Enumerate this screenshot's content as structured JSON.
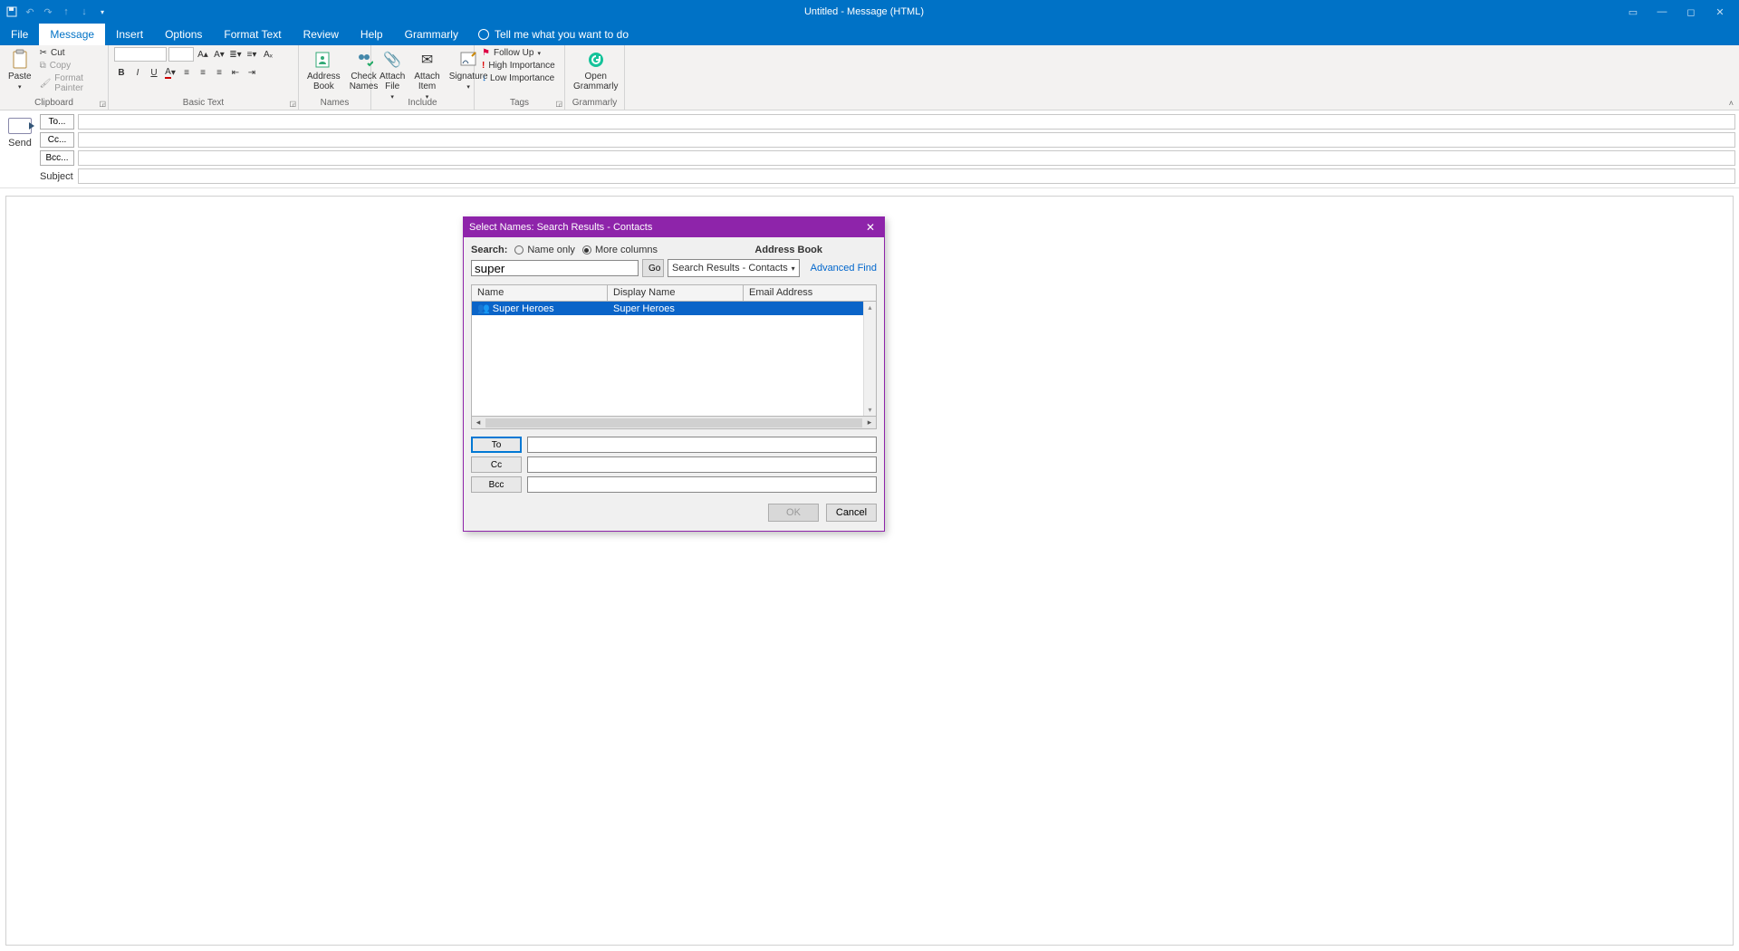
{
  "window": {
    "title": "Untitled  -  Message (HTML)"
  },
  "qat": {
    "save": "💾"
  },
  "tabs": {
    "file": "File",
    "message": "Message",
    "insert": "Insert",
    "options": "Options",
    "format_text": "Format Text",
    "review": "Review",
    "help": "Help",
    "grammarly": "Grammarly",
    "tell_me": "Tell me what you want to do"
  },
  "ribbon": {
    "clipboard": {
      "paste": "Paste",
      "cut": "Cut",
      "copy": "Copy",
      "format_painter": "Format Painter",
      "label": "Clipboard"
    },
    "basic_text": {
      "label": "Basic Text"
    },
    "names": {
      "address_book": "Address\nBook",
      "check_names": "Check\nNames",
      "label": "Names"
    },
    "include": {
      "attach_file": "Attach\nFile",
      "attach_item": "Attach\nItem",
      "signature": "Signature",
      "label": "Include"
    },
    "tags": {
      "follow_up": "Follow Up",
      "high": "High Importance",
      "low": "Low Importance",
      "label": "Tags"
    },
    "grammarly_group": {
      "open": "Open\nGrammarly",
      "label": "Grammarly"
    }
  },
  "compose": {
    "send": "Send",
    "to": "To...",
    "cc": "Cc...",
    "bcc": "Bcc...",
    "subject": "Subject"
  },
  "dialog": {
    "title": "Select Names: Search Results - Contacts",
    "search_label": "Search:",
    "name_only": "Name only",
    "more_columns": "More columns",
    "address_book_label": "Address Book",
    "search_value": "super",
    "go": "Go",
    "ab_value": "Search Results - Contacts",
    "advanced_find": "Advanced Find",
    "columns": {
      "name": "Name",
      "display": "Display Name",
      "email": "Email Address"
    },
    "rows": [
      {
        "name": "Super Heroes",
        "display": "Super Heroes",
        "email": ""
      }
    ],
    "to": "To",
    "cc": "Cc",
    "bcc": "Bcc",
    "to_value": "",
    "cc_value": "",
    "bcc_value": "",
    "ok": "OK",
    "cancel": "Cancel"
  }
}
